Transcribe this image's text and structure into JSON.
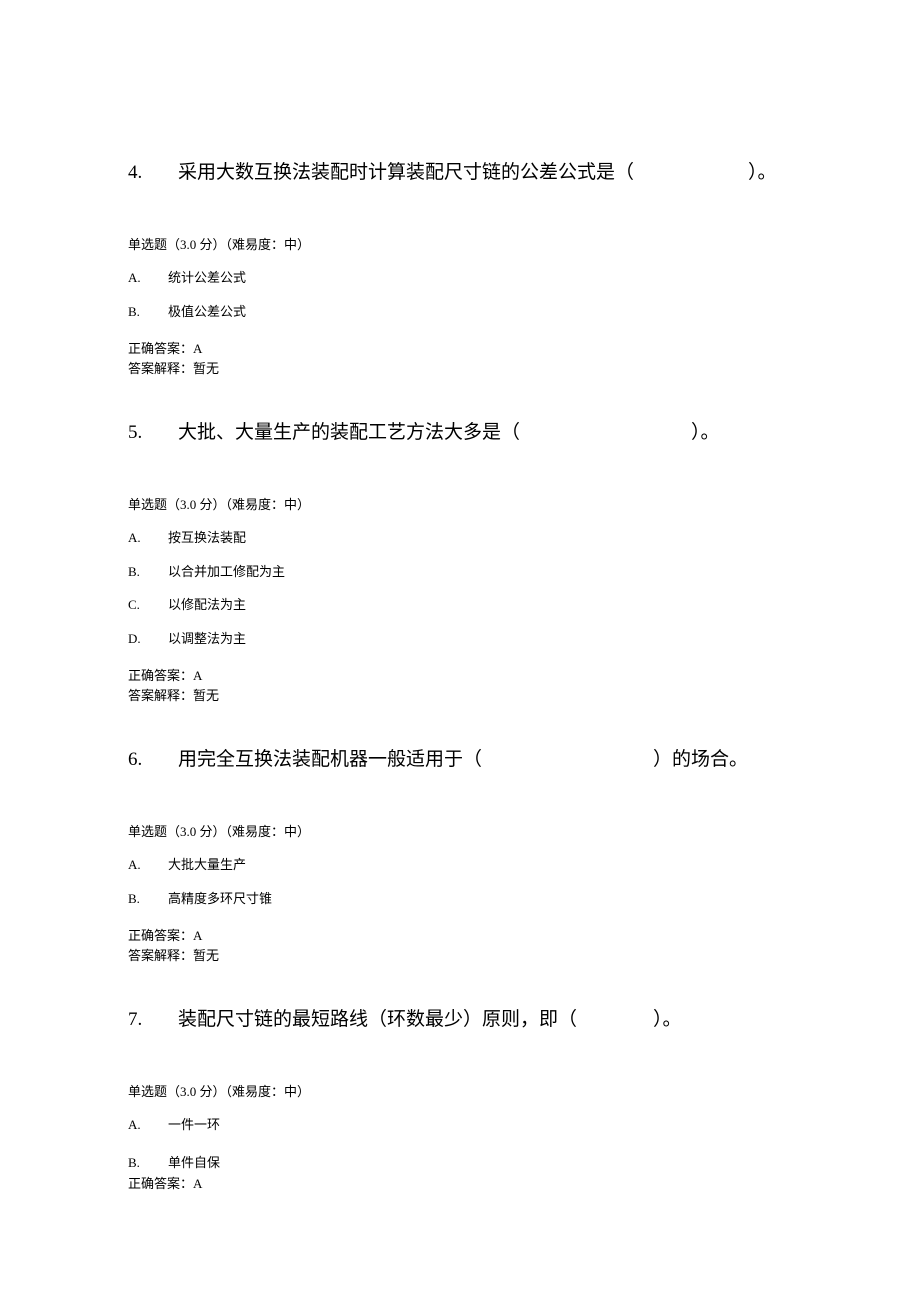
{
  "questions": {
    "q4": {
      "number": "4.",
      "text": "采用大数互换法装配时计算装配尺寸链的公差公式是（　　　　　　）。",
      "meta": "单选题（3.0 分）（难易度：中）",
      "options": {
        "A": {
          "letter": "A.",
          "text": "统计公差公式"
        },
        "B": {
          "letter": "B.",
          "text": "极值公差公式"
        }
      },
      "correct": "正确答案：A",
      "explain": "答案解释：暂无"
    },
    "q5": {
      "number": "5.",
      "text": "大批、大量生产的装配工艺方法大多是（　　　　　　　　　）。",
      "meta": "单选题（3.0 分）（难易度：中）",
      "options": {
        "A": {
          "letter": "A.",
          "text": "按互换法装配"
        },
        "B": {
          "letter": "B.",
          "text": "以合并加工修配为主"
        },
        "C": {
          "letter": "C.",
          "text": "以修配法为主"
        },
        "D": {
          "letter": "D.",
          "text": "以调整法为主"
        }
      },
      "correct": "正确答案：A",
      "explain": "答案解释：暂无"
    },
    "q6": {
      "number": "6.",
      "text": "用完全互换法装配机器一般适用于（　　　　　　　　　）的场合。",
      "meta": "单选题（3.0 分）（难易度：中）",
      "options": {
        "A": {
          "letter": "A.",
          "text": "大批大量生产"
        },
        "B": {
          "letter": "B.",
          "text": "高精度多环尺寸锥"
        }
      },
      "correct": "正确答案：A",
      "explain": "答案解释：暂无"
    },
    "q7": {
      "number": "7.",
      "text": "装配尺寸链的最短路线（环数最少）原则，即（　　　　）。",
      "meta": "单选题（3.0 分）（难易度：中）",
      "options": {
        "A": {
          "letter": "A.",
          "text": "一件一环"
        },
        "B": {
          "letter": "B.",
          "text": "单件自保"
        }
      },
      "correct": "正确答案：A"
    }
  }
}
